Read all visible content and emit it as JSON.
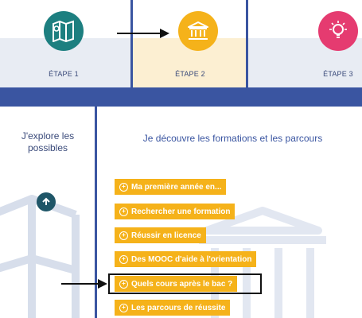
{
  "steps": [
    {
      "label": "ÉTAPE 1",
      "icon": "map-icon",
      "color": "#1d7f80"
    },
    {
      "label": "ÉTAPE 2",
      "icon": "institution-icon",
      "color": "#f5b21a"
    },
    {
      "label": "ÉTAPE 3",
      "icon": "lightbulb-icon",
      "color": "#e53b70"
    }
  ],
  "left_panel": {
    "title": "J'explore les possibles",
    "icon": "arrow-up-icon"
  },
  "right_panel": {
    "title": "Je découvre les formations et les parcours",
    "items": [
      {
        "label": "Ma première année en..."
      },
      {
        "label": "Rechercher une formation"
      },
      {
        "label": "Réussir en licence"
      },
      {
        "label": "Des MOOC d'aide à l'orientation"
      },
      {
        "label": "Quels cours après le bac ?"
      },
      {
        "label": "Les parcours de réussite"
      }
    ]
  },
  "colors": {
    "accent_orange": "#f5b21a",
    "navy": "#3a55a1",
    "teal": "#1d7f80",
    "pink": "#e53b70"
  }
}
